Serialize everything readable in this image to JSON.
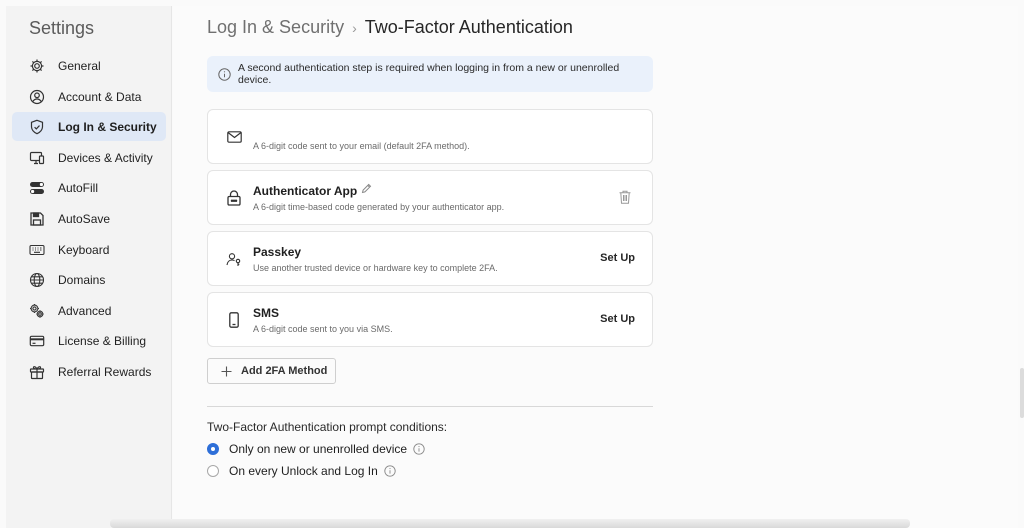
{
  "sidebar": {
    "title": "Settings",
    "items": [
      {
        "label": "General",
        "icon": "gear-icon"
      },
      {
        "label": "Account & Data",
        "icon": "person-circle-icon"
      },
      {
        "label": "Log In & Security",
        "icon": "shield-lock-icon",
        "active": true
      },
      {
        "label": "Devices & Activity",
        "icon": "devices-icon"
      },
      {
        "label": "AutoFill",
        "icon": "toggles-icon"
      },
      {
        "label": "AutoSave",
        "icon": "save-icon"
      },
      {
        "label": "Keyboard",
        "icon": "keyboard-icon"
      },
      {
        "label": "Domains",
        "icon": "globe-icon"
      },
      {
        "label": "Advanced",
        "icon": "gears-icon"
      },
      {
        "label": "License & Billing",
        "icon": "credit-card-icon"
      },
      {
        "label": "Referral Rewards",
        "icon": "gift-icon"
      }
    ]
  },
  "breadcrumb": {
    "parent": "Log In & Security",
    "separator": "›",
    "current": "Two-Factor Authentication"
  },
  "banner": {
    "text": "A second authentication step is required when logging in from a new or unenrolled device.",
    "icon": "info-icon"
  },
  "methods": [
    {
      "title": "",
      "description": "A 6-digit code sent to your email (default 2FA method).",
      "icon": "envelope-icon",
      "action": ""
    },
    {
      "title": "Authenticator App",
      "description": "A 6-digit time-based code generated by your authenticator app.",
      "icon": "lock-icon",
      "edit_icon": "pencil-icon",
      "delete_icon": "trash-icon"
    },
    {
      "title": "Passkey",
      "description": "Use another trusted device or hardware key to complete 2FA.",
      "icon": "person-key-icon",
      "action": "Set Up"
    },
    {
      "title": "SMS",
      "description": "A 6-digit code sent to you via SMS.",
      "icon": "phone-icon",
      "action": "Set Up"
    }
  ],
  "add_button": {
    "label": "Add 2FA Method",
    "icon": "plus-icon"
  },
  "conditions": {
    "title": "Two-Factor Authentication prompt conditions:",
    "options": [
      {
        "label": "Only on new or unenrolled device",
        "selected": true
      },
      {
        "label": "On every Unlock and Log In",
        "selected": false
      }
    ]
  },
  "colors": {
    "accent": "#2e6fd8",
    "active_nav": "#dfe8f6",
    "banner": "#eaf1fb"
  }
}
